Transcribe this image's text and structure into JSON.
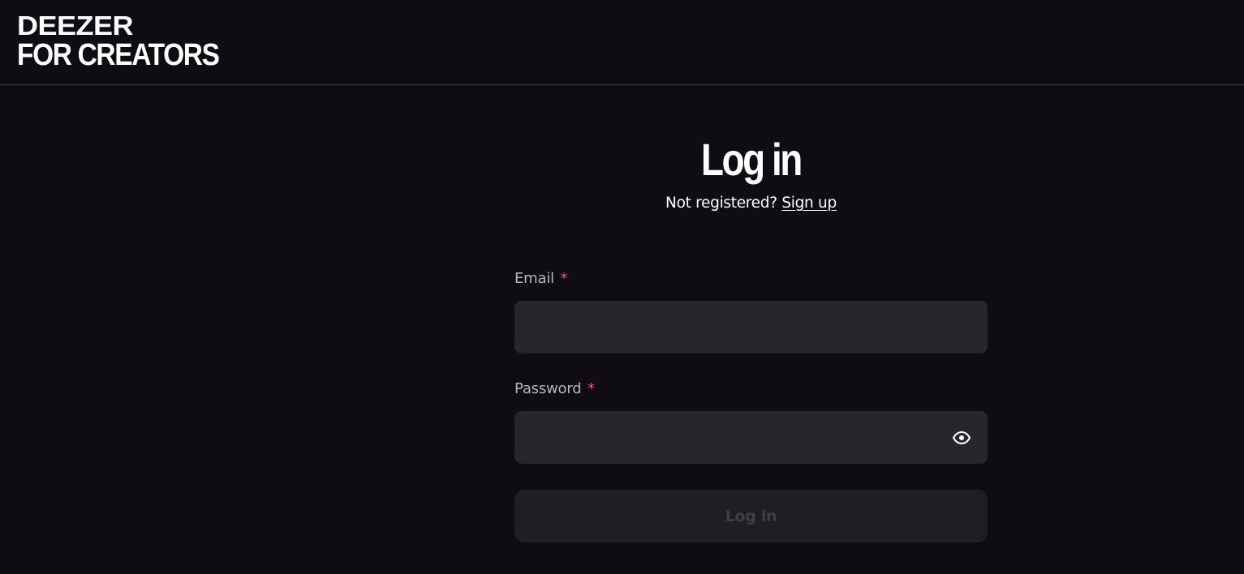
{
  "brand": {
    "logo_line1": "DEEZER",
    "logo_line2": "FOR CREATORS"
  },
  "login": {
    "title": "Log in",
    "not_registered_text": "Not registered?",
    "signup_link": "Sign up",
    "email_label": "Email",
    "email_value": "",
    "password_label": "Password",
    "password_value": "",
    "required_marker": "*",
    "submit_label": "Log in",
    "submit_enabled": false
  },
  "icons": {
    "password_toggle": "eye-icon"
  },
  "colors": {
    "background": "#0f0d13",
    "field_background": "#27262c",
    "required_marker": "#ef5466",
    "label": "#b6b4bc",
    "button_disabled_bg": "#1f1e24",
    "button_disabled_text": "#3f3e45"
  }
}
